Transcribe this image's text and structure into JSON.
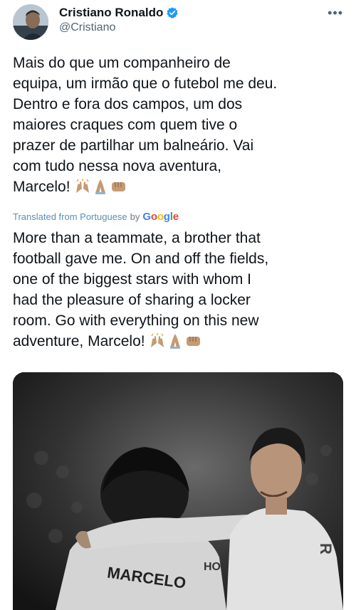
{
  "author": {
    "display_name": "Cristiano Ronaldo",
    "handle": "@Cristiano",
    "verified": true,
    "verified_color": "#1d9bf0"
  },
  "menu_icon": "more-horizontal-icon",
  "tweet": {
    "original_text": "Mais do que um companheiro de\nequipa, um irmão que o futebol me deu.\nDentro e fora dos campos, um dos\nmaiores craques com quem tive o\nprazer de partilhar um balneário. Vai\ncom tudo nessa nova aventura,\nMarcelo!",
    "translated_text": "More than a teammate, a brother that\nfootball gave me. On and off the fields,\none of the biggest stars with whom I\nhad the pleasure of sharing a locker\nroom. Go with everything on this new\nadventure, Marcelo!",
    "emojis": [
      "raising-hands-icon",
      "folded-hands-icon",
      "fist-bump-icon"
    ]
  },
  "translation": {
    "label": "Translated from Portuguese",
    "by": "by",
    "provider": [
      "G",
      "o",
      "o",
      "g",
      "l",
      "e"
    ],
    "link_color": "#5b8fb5"
  },
  "media": {
    "jersey_text": "MARCELO",
    "jersey_number_fragment": "HO"
  }
}
